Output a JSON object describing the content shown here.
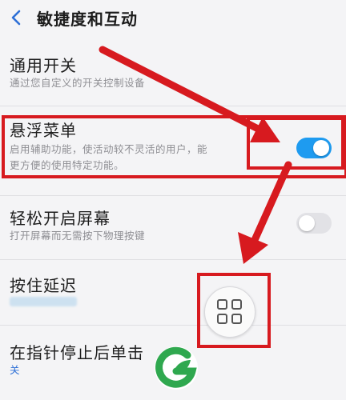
{
  "header": {
    "title": "敏捷度和互动"
  },
  "rows": [
    {
      "title": "通用开关",
      "subtitle": "通过您自定义的开关控制设备"
    },
    {
      "title": "悬浮菜单",
      "subtitle_line1": "启用辅助功能，使活动较不灵活的用户，能",
      "subtitle_line2": "更方便的使用特定功能。",
      "toggle_state": "on"
    },
    {
      "title": "轻松开启屏幕",
      "subtitle": "打开屏幕而无需按下物理按键",
      "toggle_state": "off"
    },
    {
      "title": "按住延迟"
    },
    {
      "title": "在指针停止后单击",
      "value": "关"
    }
  ],
  "colors": {
    "accent_blue": "#1e9bf0",
    "highlight_red": "#d71a1f",
    "logo_green": "#2fa84f"
  },
  "icons": {
    "back": "chevron-left-icon",
    "floating_menu": "grid-four-squares-icon"
  }
}
